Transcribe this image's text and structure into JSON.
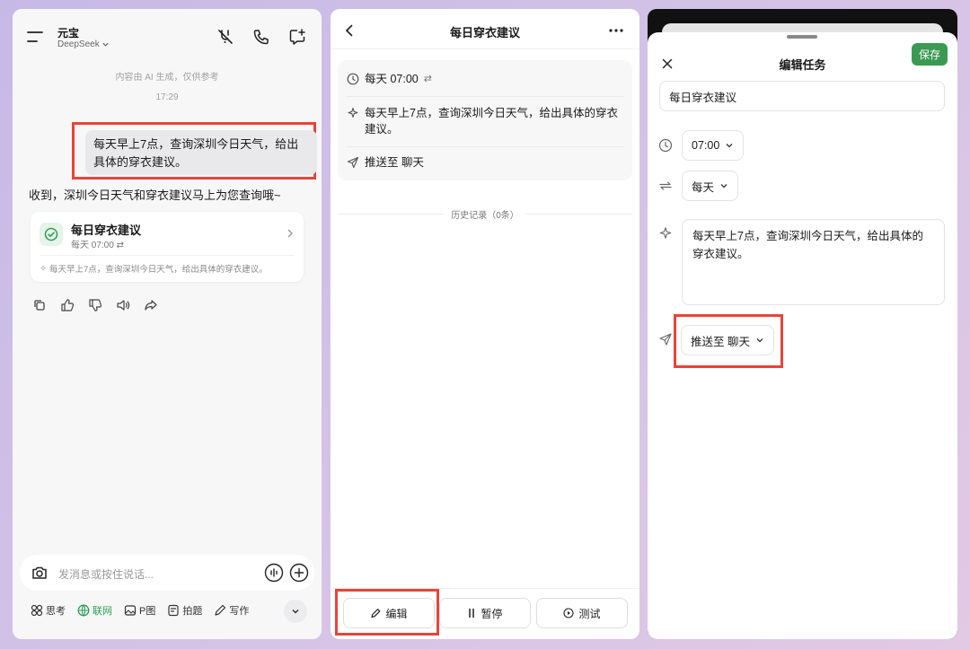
{
  "chat": {
    "app_name": "元宝",
    "model": "DeepSeek",
    "ai_notice": "内容由 AI 生成，仅供参考",
    "timestamp": "17:29",
    "user_message": "每天早上7点，查询深圳今日天气，给出具体的穿衣建议。",
    "assistant_reply": "收到，深圳今日天气和穿衣建议马上为您查询哦~",
    "task_card": {
      "title": "每日穿衣建议",
      "time": "每天 07:00",
      "description": "每天早上7点，查询深圳今日天气，给出具体的穿衣建议。"
    },
    "input_placeholder": "发消息或按住说话...",
    "tools": [
      "思考",
      "联网",
      "P图",
      "拍题",
      "写作"
    ]
  },
  "detail": {
    "title": "每日穿衣建议",
    "schedule": "每天 07:00",
    "prompt": "每天早上7点，查询深圳今日天气，给出具体的穿衣建议。",
    "push_target": "推送至 聊天",
    "history_label": "历史记录（0条）",
    "buttons": {
      "edit": "编辑",
      "pause": "暂停",
      "test": "测试"
    }
  },
  "edit": {
    "title": "编辑任务",
    "save_label": "保存",
    "task_name": "每日穿衣建议",
    "time": "07:00",
    "repeat": "每天",
    "prompt": "每天早上7点，查询深圳今日天气，给出具体的穿衣建议。",
    "push_target": "推送至 聊天"
  },
  "colors": {
    "accent_green": "#3b9a52",
    "highlight_red": "#e8443a"
  }
}
